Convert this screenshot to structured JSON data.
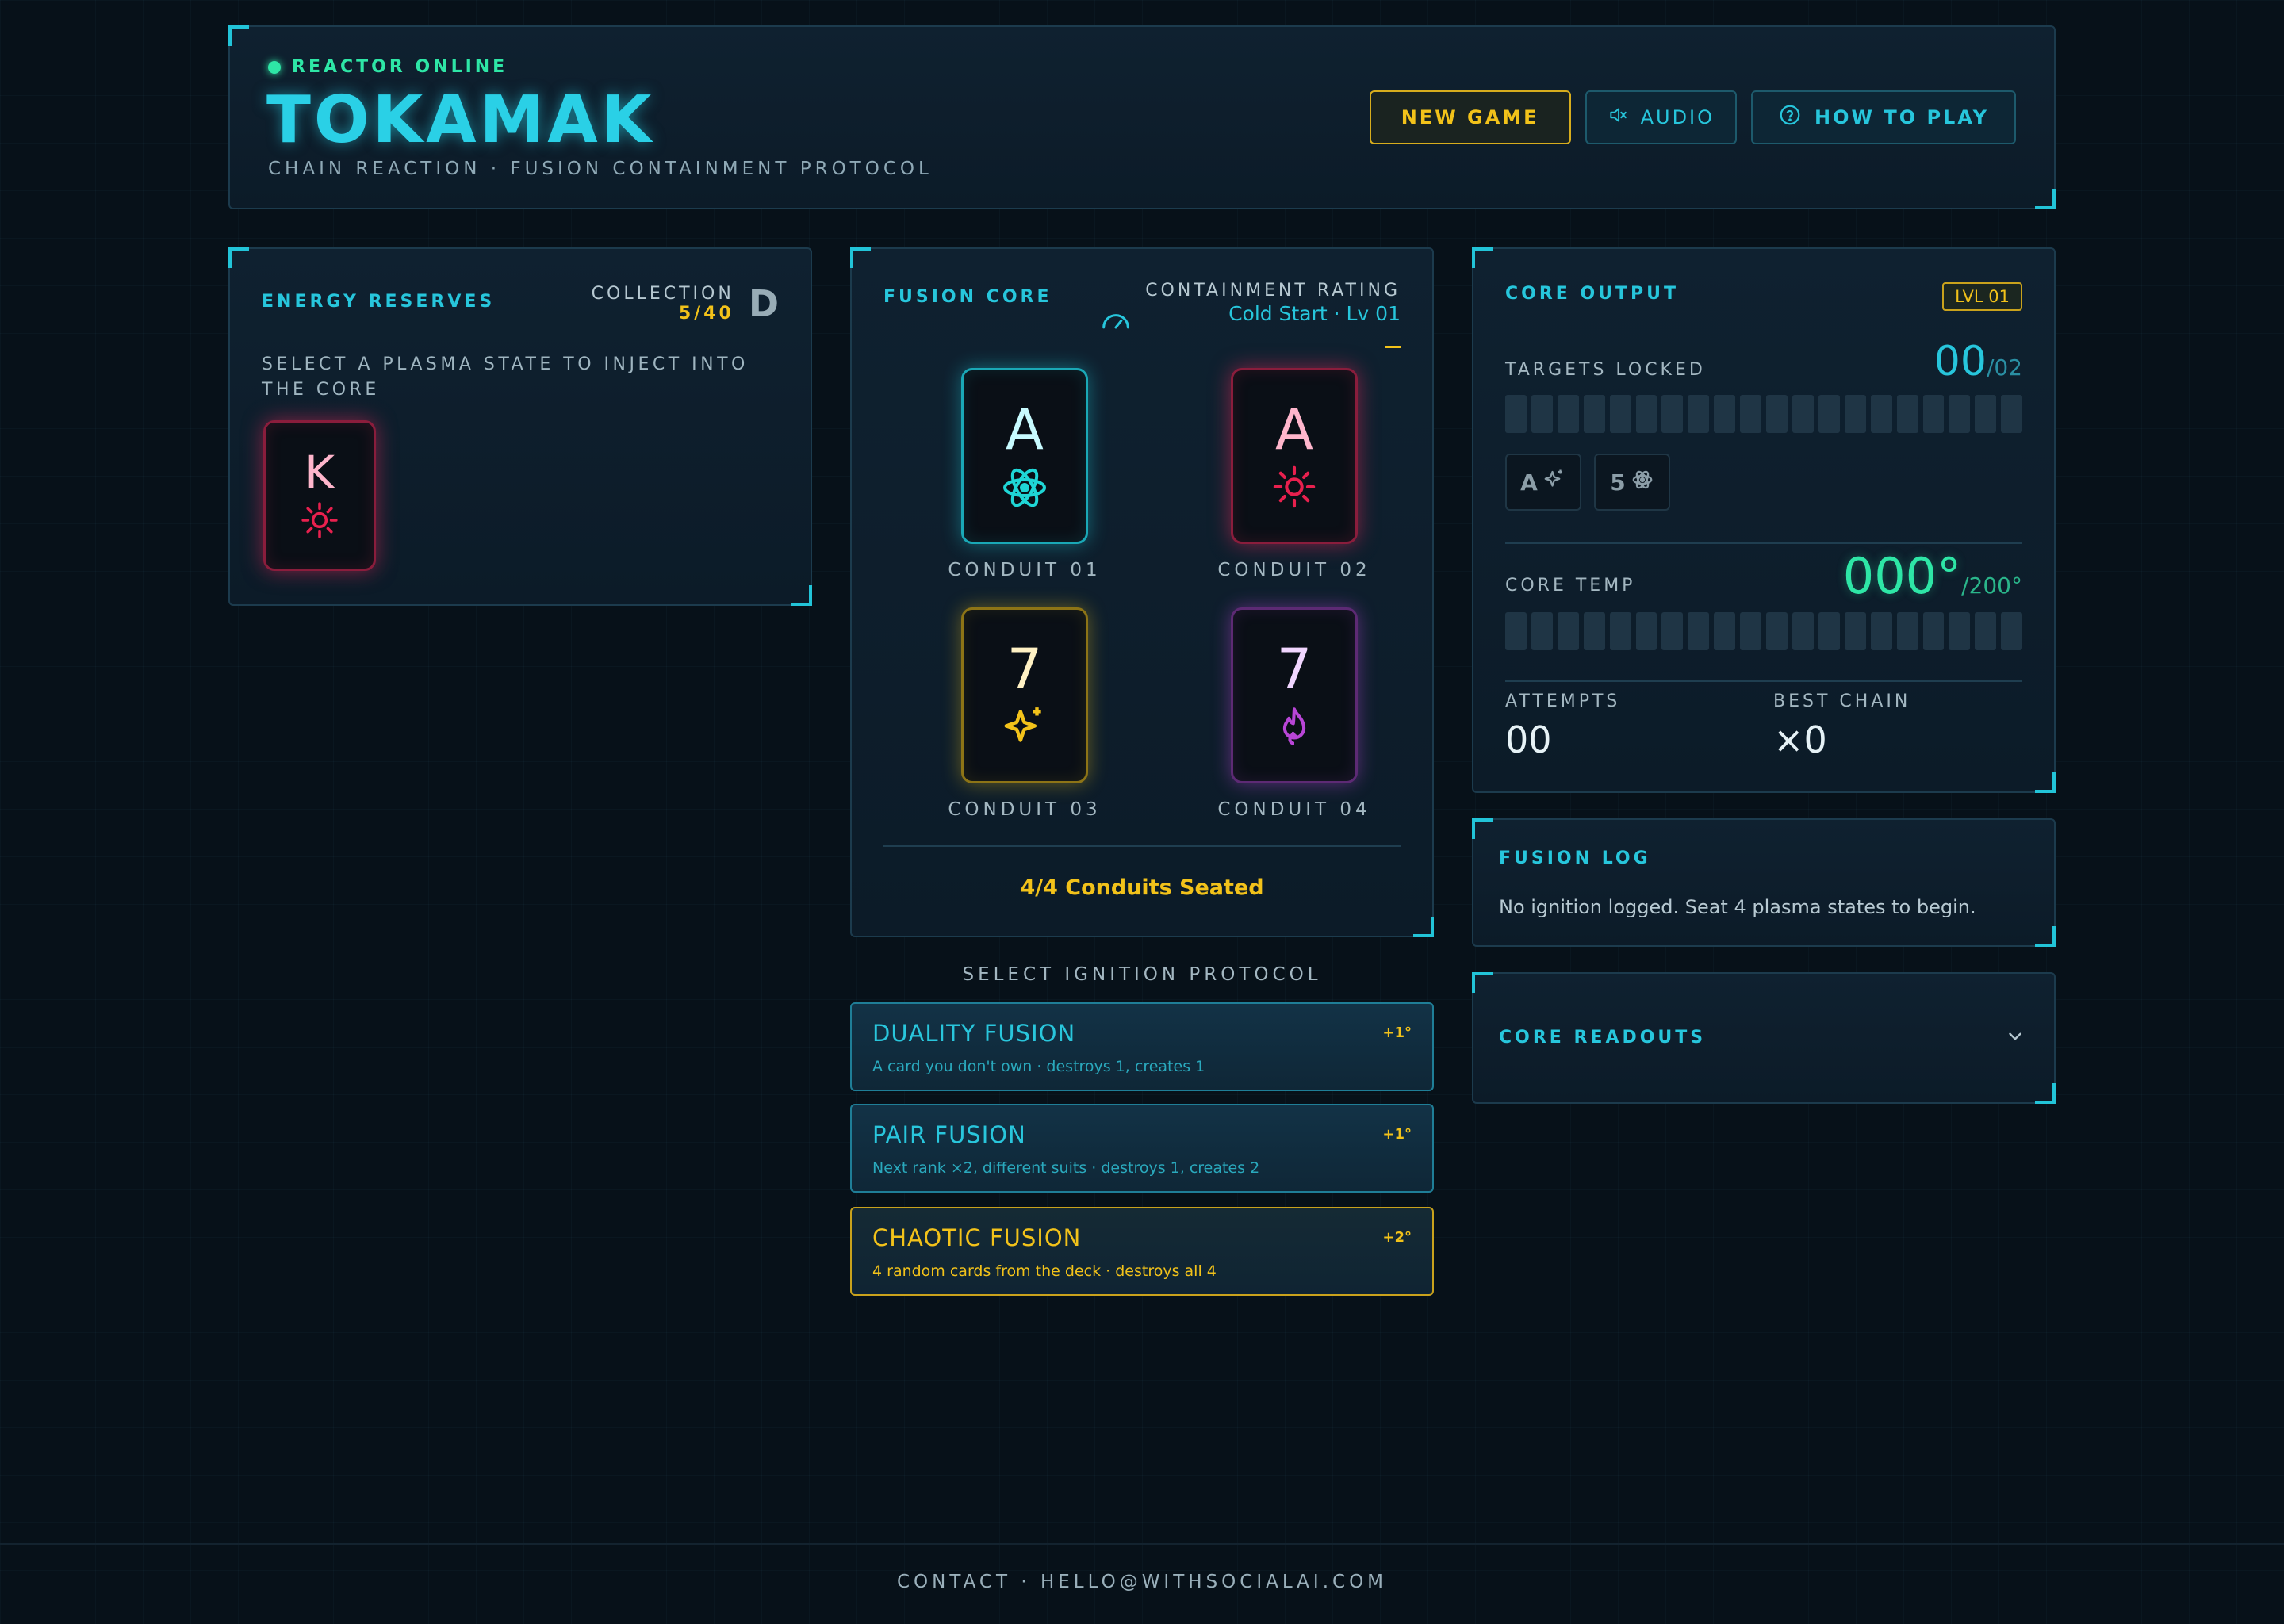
{
  "header": {
    "status": "REACTOR ONLINE",
    "title": "TOKAMAK",
    "subtitle": "CHAIN REACTION · FUSION CONTAINMENT PROTOCOL",
    "buttons": {
      "new_game": "NEW GAME",
      "audio": "AUDIO",
      "how_to_play": "HOW TO PLAY"
    }
  },
  "reserves": {
    "label": "ENERGY RESERVES",
    "collection_label": "COLLECTION",
    "collection_count": "5/40",
    "grade": "D",
    "prompt": "SELECT A PLASMA STATE TO INJECT INTO THE CORE",
    "cards": [
      {
        "rank": "K",
        "suit": "sun-icon",
        "color": "#e8204e"
      }
    ]
  },
  "core": {
    "label": "FUSION CORE",
    "rating_label": "CONTAINMENT RATING",
    "rating_value": "Cold Start · Lv 01",
    "conduits": [
      {
        "rank": "A",
        "suit": "atom-icon",
        "label": "CONDUIT 01",
        "color": "#1fd6d6"
      },
      {
        "rank": "A",
        "suit": "sun-icon",
        "label": "CONDUIT 02",
        "color": "#e8204e"
      },
      {
        "rank": "7",
        "suit": "sparkle-icon",
        "label": "CONDUIT 03",
        "color": "#f2c21a"
      },
      {
        "rank": "7",
        "suit": "flame-icon",
        "label": "CONDUIT 04",
        "color": "#b845d6"
      }
    ],
    "seated": "4/4 Conduits Seated"
  },
  "ignition": {
    "label": "SELECT IGNITION PROTOCOL",
    "protocols": [
      {
        "name": "DUALITY FUSION",
        "cost": "+1°",
        "desc": "A card you don't own · destroys 1, creates 1"
      },
      {
        "name": "PAIR FUSION",
        "cost": "+1°",
        "desc": "Next rank ×2, different suits · destroys 1, creates 2"
      },
      {
        "name": "CHAOTIC FUSION",
        "cost": "+2°",
        "desc": "4 random cards from the deck · destroys all 4"
      }
    ]
  },
  "output": {
    "label": "CORE OUTPUT",
    "level": "LVL 01",
    "targets_label": "TARGETS LOCKED",
    "targets_value": "00",
    "targets_max": "/02",
    "target_chips": [
      {
        "rank": "A",
        "suit": "sparkle-icon"
      },
      {
        "rank": "5",
        "suit": "atom-icon"
      }
    ],
    "temp_label": "CORE TEMP",
    "temp_value": "000°",
    "temp_max": "/200°",
    "attempts_label": "ATTEMPTS",
    "attempts_value": "00",
    "best_label": "BEST CHAIN",
    "best_value": "×0"
  },
  "log": {
    "label": "FUSION LOG",
    "text": "No ignition logged. Seat 4 plasma states to begin."
  },
  "readouts": {
    "label": "CORE READOUTS"
  },
  "footer": {
    "contact": "CONTACT · HELLO@WITHSOCIALAI.COM"
  }
}
